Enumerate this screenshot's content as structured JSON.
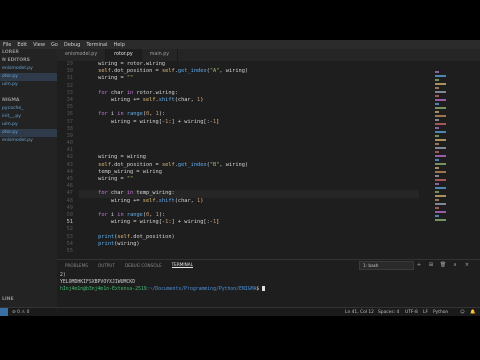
{
  "menubar": {
    "items": [
      "File",
      "Edit",
      "View",
      "Go",
      "Debug",
      "Terminal",
      "Help"
    ]
  },
  "sidebar": {
    "rows": [
      {
        "text": "LORER",
        "type": "head"
      },
      {
        "text": "N EDITORS",
        "type": "head"
      },
      {
        "text": "enismodel.py",
        "type": "file"
      },
      {
        "text": "otor.py",
        "type": "file",
        "active": true
      },
      {
        "text": "uim.py",
        "type": "file"
      },
      {
        "text": "",
        "type": "gap"
      },
      {
        "text": "NIGMA",
        "type": "head"
      },
      {
        "text": "pycache_",
        "type": "file"
      },
      {
        "text": "init__.py",
        "type": "file"
      },
      {
        "text": "uim.py",
        "type": "file"
      },
      {
        "text": "otor.py",
        "type": "file",
        "active": true
      },
      {
        "text": "enismodel.py",
        "type": "file"
      }
    ],
    "footer_label": "LINE"
  },
  "tabs": [
    {
      "label": "enismodel.py",
      "active": false
    },
    {
      "label": "rotor.py",
      "active": true
    },
    {
      "label": "main.py",
      "active": false
    }
  ],
  "editor": {
    "line_numbers": [
      "29",
      "30",
      "31",
      "32",
      "33",
      "34",
      "35",
      "36",
      "37",
      "38",
      "39",
      "40",
      "41",
      "42",
      "43",
      "44",
      "45",
      "46",
      "47",
      "48",
      "49",
      "50",
      "51",
      "52",
      "53",
      "54",
      "55"
    ],
    "current_line_index": 22
  },
  "minimap": {
    "colors": [
      "#c678dd",
      "#61afef",
      "#98c379",
      "#e5c07b",
      "#d19a66",
      "#abb2bf",
      "#e06c75"
    ]
  },
  "panel": {
    "tabs": [
      "PROBLEMS",
      "OUTPUT",
      "DEBUG CONSOLE",
      "TERMINAL"
    ],
    "active_tab": "TERMINAL",
    "terminal_select": "1: bash",
    "buttons": {
      "add": "+",
      "split": "⊞",
      "trash": "🗑",
      "maximize": "∧",
      "close": "×"
    },
    "lines": [
      "2)",
      "YELOMDHKIFSXBPVOYXJIWUMCKD"
    ],
    "prompt_user": "hInj4m1n@b3nj4m1n-Extensa-2519",
    "prompt_path": ":~/Documents/Programming/Python/ENIGMA",
    "prompt_suffix": "$ "
  },
  "statusbar": {
    "left_counts": "⊘ 0  ⚠ 0",
    "position": "Ln 41, Col 12",
    "spaces": "Spaces: 4",
    "encoding": "UTF-8",
    "eol": "LF",
    "language": "Python"
  }
}
